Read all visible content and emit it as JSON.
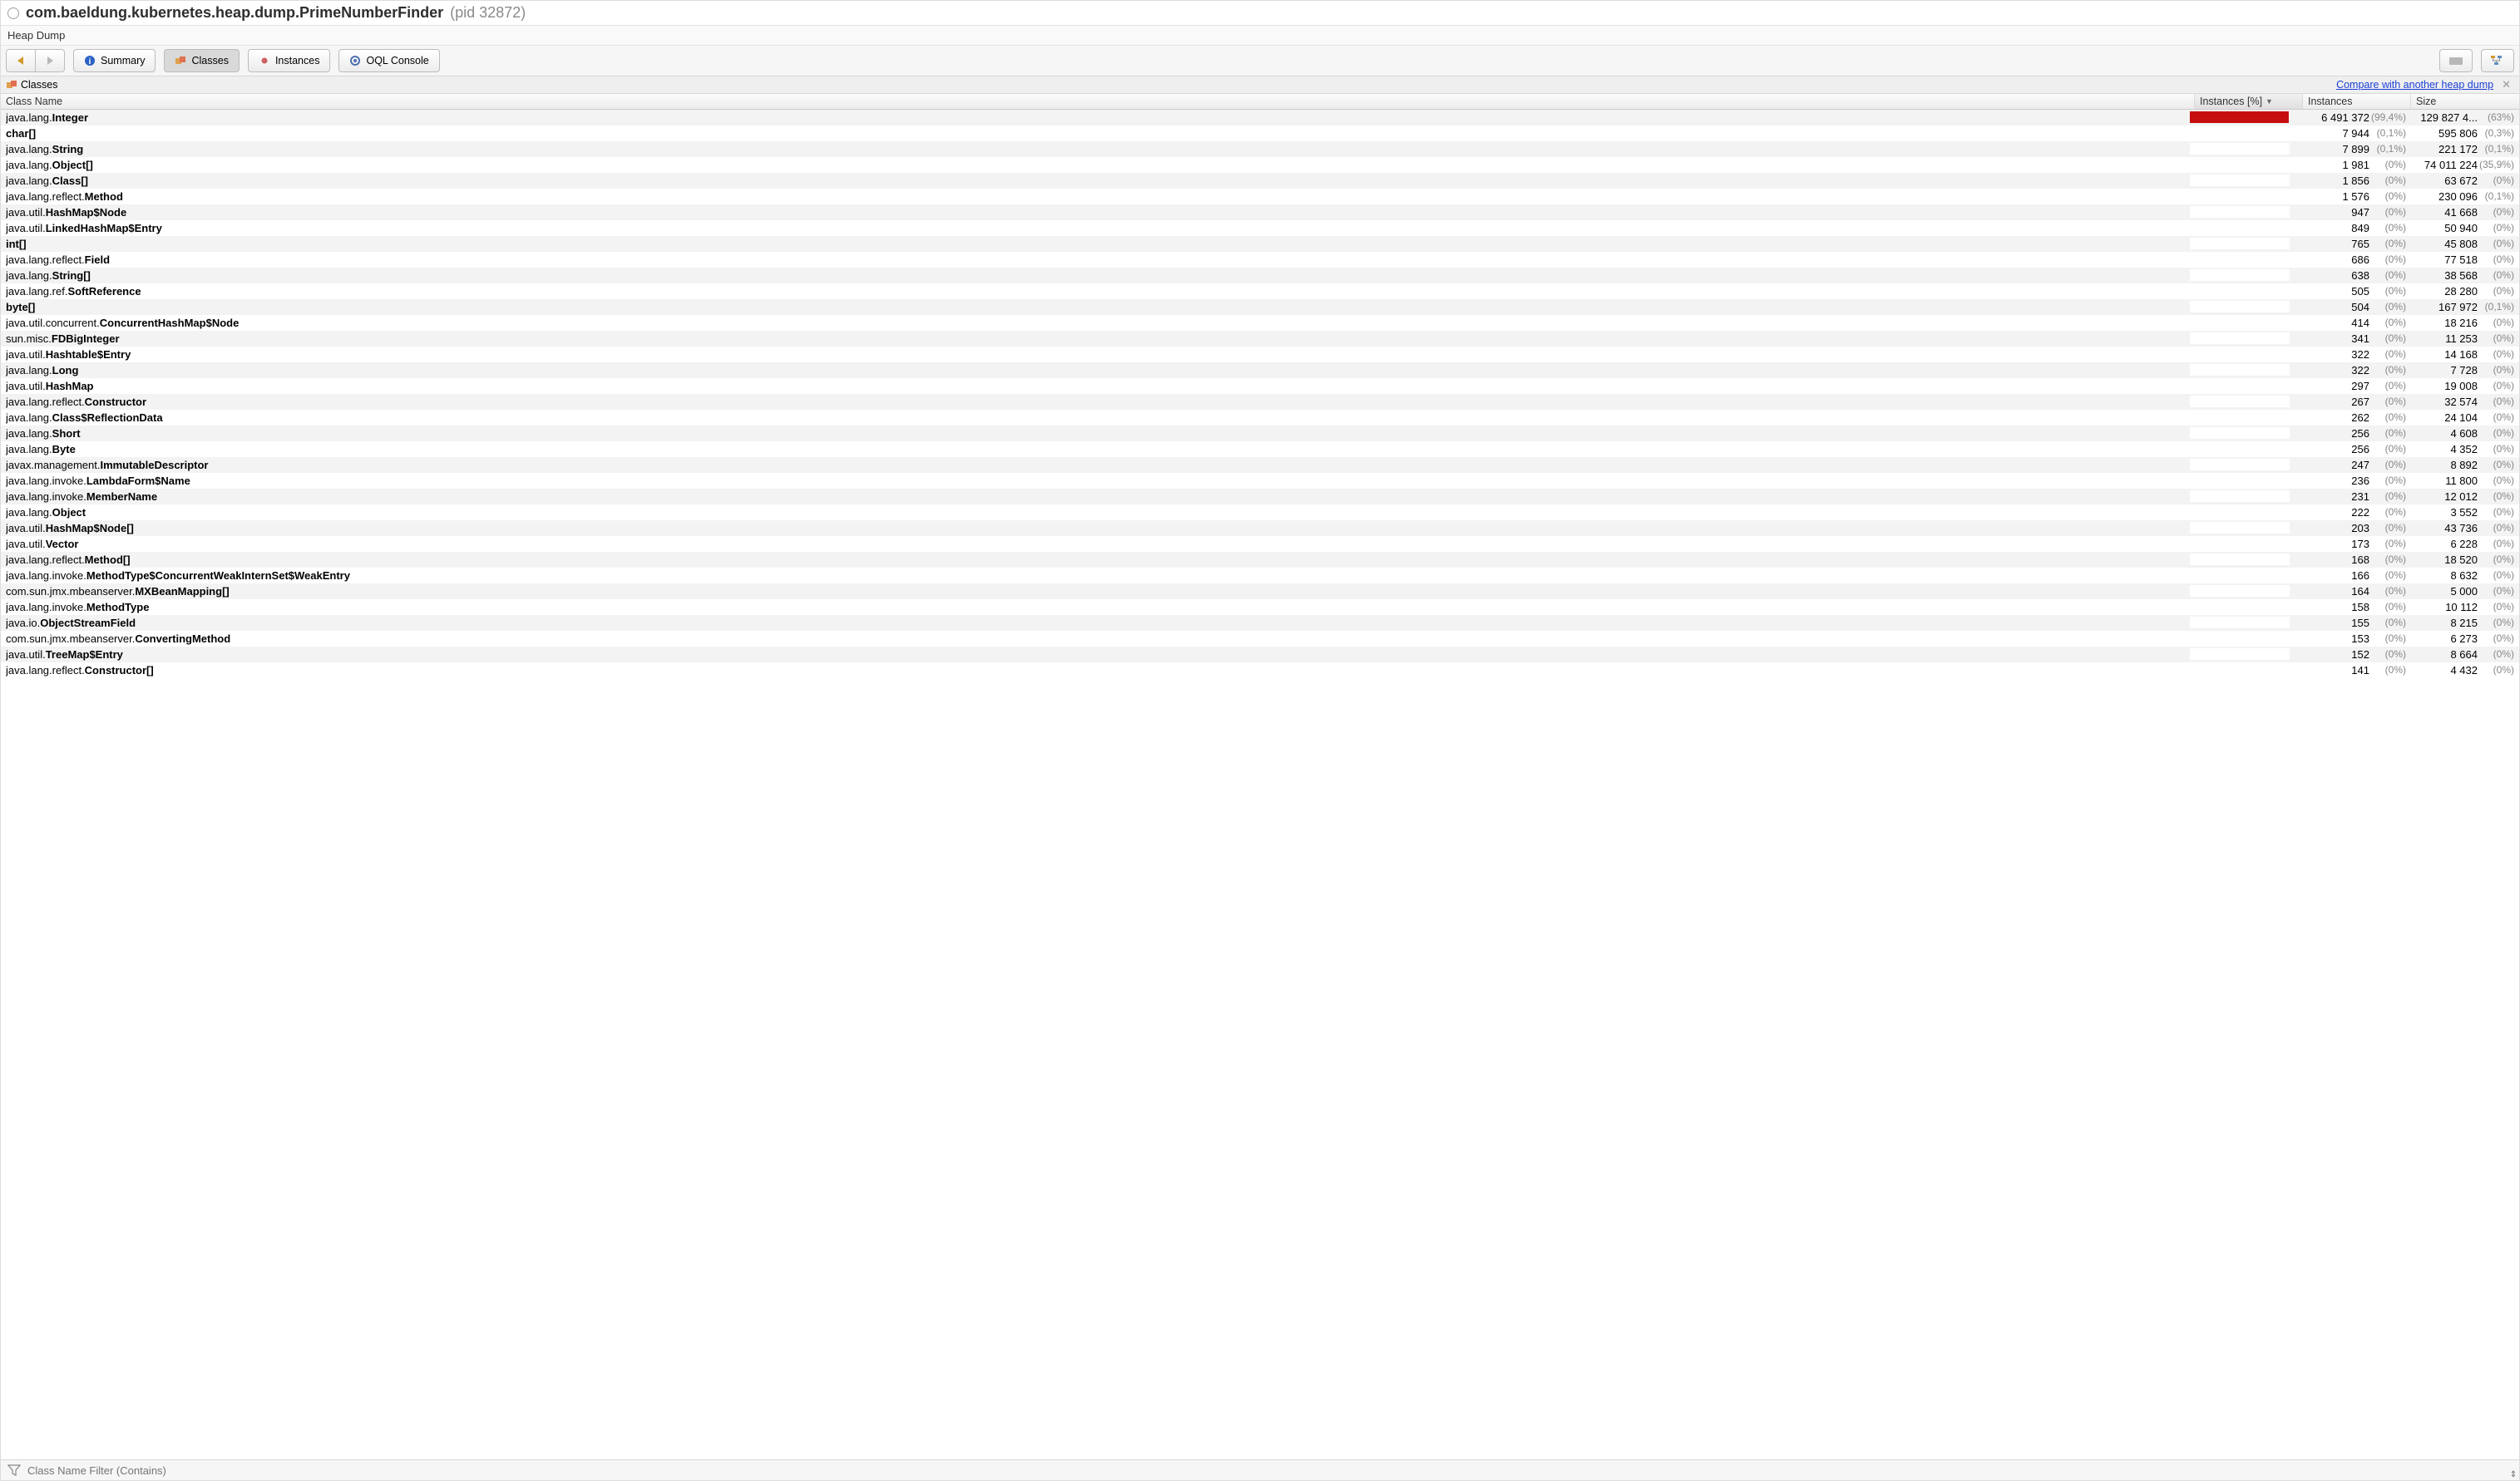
{
  "title": {
    "main": "com.baeldung.kubernetes.heap.dump.PrimeNumberFinder",
    "pid": "(pid 32872)"
  },
  "subheader": "Heap Dump",
  "toolbar": {
    "summary": "Summary",
    "classes": "Classes",
    "instances": "Instances",
    "oql": "OQL Console"
  },
  "section": {
    "label": "Classes",
    "compare_link": "Compare with another heap dump"
  },
  "columns": {
    "name": "Class Name",
    "pct": "Instances [%]",
    "instances": "Instances",
    "size": "Size"
  },
  "filter_placeholder": "Class Name Filter (Contains)",
  "rows": [
    {
      "pkg": "java.lang.",
      "cls": "Integer",
      "bar": 99.4,
      "inst": "6 491 372",
      "inst_pct": "(99,4%)",
      "size": "129 827 4...",
      "size_pct": "(63%)"
    },
    {
      "pkg": "",
      "cls": "char[]",
      "bar": 0,
      "inst": "7 944",
      "inst_pct": "(0,1%)",
      "size": "595 806",
      "size_pct": "(0,3%)"
    },
    {
      "pkg": "java.lang.",
      "cls": "String",
      "bar": 0,
      "inst": "7 899",
      "inst_pct": "(0,1%)",
      "size": "221 172",
      "size_pct": "(0,1%)"
    },
    {
      "pkg": "java.lang.",
      "cls": "Object[]",
      "bar": 0,
      "inst": "1 981",
      "inst_pct": "(0%)",
      "size": "74 011 224",
      "size_pct": "(35,9%)"
    },
    {
      "pkg": "java.lang.",
      "cls": "Class[]",
      "bar": 0,
      "inst": "1 856",
      "inst_pct": "(0%)",
      "size": "63 672",
      "size_pct": "(0%)"
    },
    {
      "pkg": "java.lang.reflect.",
      "cls": "Method",
      "bar": 0,
      "inst": "1 576",
      "inst_pct": "(0%)",
      "size": "230 096",
      "size_pct": "(0,1%)"
    },
    {
      "pkg": "java.util.",
      "cls": "HashMap$Node",
      "bar": 0,
      "inst": "947",
      "inst_pct": "(0%)",
      "size": "41 668",
      "size_pct": "(0%)"
    },
    {
      "pkg": "java.util.",
      "cls": "LinkedHashMap$Entry",
      "bar": 0,
      "inst": "849",
      "inst_pct": "(0%)",
      "size": "50 940",
      "size_pct": "(0%)"
    },
    {
      "pkg": "",
      "cls": "int[]",
      "bar": 0,
      "inst": "765",
      "inst_pct": "(0%)",
      "size": "45 808",
      "size_pct": "(0%)"
    },
    {
      "pkg": "java.lang.reflect.",
      "cls": "Field",
      "bar": 0,
      "inst": "686",
      "inst_pct": "(0%)",
      "size": "77 518",
      "size_pct": "(0%)"
    },
    {
      "pkg": "java.lang.",
      "cls": "String[]",
      "bar": 0,
      "inst": "638",
      "inst_pct": "(0%)",
      "size": "38 568",
      "size_pct": "(0%)"
    },
    {
      "pkg": "java.lang.ref.",
      "cls": "SoftReference",
      "bar": 0,
      "inst": "505",
      "inst_pct": "(0%)",
      "size": "28 280",
      "size_pct": "(0%)"
    },
    {
      "pkg": "",
      "cls": "byte[]",
      "bar": 0,
      "inst": "504",
      "inst_pct": "(0%)",
      "size": "167 972",
      "size_pct": "(0,1%)"
    },
    {
      "pkg": "java.util.concurrent.",
      "cls": "ConcurrentHashMap$Node",
      "bar": 0,
      "inst": "414",
      "inst_pct": "(0%)",
      "size": "18 216",
      "size_pct": "(0%)"
    },
    {
      "pkg": "sun.misc.",
      "cls": "FDBigInteger",
      "bar": 0,
      "inst": "341",
      "inst_pct": "(0%)",
      "size": "11 253",
      "size_pct": "(0%)"
    },
    {
      "pkg": "java.util.",
      "cls": "Hashtable$Entry",
      "bar": 0,
      "inst": "322",
      "inst_pct": "(0%)",
      "size": "14 168",
      "size_pct": "(0%)"
    },
    {
      "pkg": "java.lang.",
      "cls": "Long",
      "bar": 0,
      "inst": "322",
      "inst_pct": "(0%)",
      "size": "7 728",
      "size_pct": "(0%)"
    },
    {
      "pkg": "java.util.",
      "cls": "HashMap",
      "bar": 0,
      "inst": "297",
      "inst_pct": "(0%)",
      "size": "19 008",
      "size_pct": "(0%)"
    },
    {
      "pkg": "java.lang.reflect.",
      "cls": "Constructor",
      "bar": 0,
      "inst": "267",
      "inst_pct": "(0%)",
      "size": "32 574",
      "size_pct": "(0%)"
    },
    {
      "pkg": "java.lang.",
      "cls": "Class$ReflectionData",
      "bar": 0,
      "inst": "262",
      "inst_pct": "(0%)",
      "size": "24 104",
      "size_pct": "(0%)"
    },
    {
      "pkg": "java.lang.",
      "cls": "Short",
      "bar": 0,
      "inst": "256",
      "inst_pct": "(0%)",
      "size": "4 608",
      "size_pct": "(0%)"
    },
    {
      "pkg": "java.lang.",
      "cls": "Byte",
      "bar": 0,
      "inst": "256",
      "inst_pct": "(0%)",
      "size": "4 352",
      "size_pct": "(0%)"
    },
    {
      "pkg": "javax.management.",
      "cls": "ImmutableDescriptor",
      "bar": 0,
      "inst": "247",
      "inst_pct": "(0%)",
      "size": "8 892",
      "size_pct": "(0%)"
    },
    {
      "pkg": "java.lang.invoke.",
      "cls": "LambdaForm$Name",
      "bar": 0,
      "inst": "236",
      "inst_pct": "(0%)",
      "size": "11 800",
      "size_pct": "(0%)"
    },
    {
      "pkg": "java.lang.invoke.",
      "cls": "MemberName",
      "bar": 0,
      "inst": "231",
      "inst_pct": "(0%)",
      "size": "12 012",
      "size_pct": "(0%)"
    },
    {
      "pkg": "java.lang.",
      "cls": "Object",
      "bar": 0,
      "inst": "222",
      "inst_pct": "(0%)",
      "size": "3 552",
      "size_pct": "(0%)"
    },
    {
      "pkg": "java.util.",
      "cls": "HashMap$Node[]",
      "bar": 0,
      "inst": "203",
      "inst_pct": "(0%)",
      "size": "43 736",
      "size_pct": "(0%)"
    },
    {
      "pkg": "java.util.",
      "cls": "Vector",
      "bar": 0,
      "inst": "173",
      "inst_pct": "(0%)",
      "size": "6 228",
      "size_pct": "(0%)"
    },
    {
      "pkg": "java.lang.reflect.",
      "cls": "Method[]",
      "bar": 0,
      "inst": "168",
      "inst_pct": "(0%)",
      "size": "18 520",
      "size_pct": "(0%)"
    },
    {
      "pkg": "java.lang.invoke.",
      "cls": "MethodType$ConcurrentWeakInternSet$WeakEntry",
      "bar": 0,
      "inst": "166",
      "inst_pct": "(0%)",
      "size": "8 632",
      "size_pct": "(0%)"
    },
    {
      "pkg": "com.sun.jmx.mbeanserver.",
      "cls": "MXBeanMapping[]",
      "bar": 0,
      "inst": "164",
      "inst_pct": "(0%)",
      "size": "5 000",
      "size_pct": "(0%)"
    },
    {
      "pkg": "java.lang.invoke.",
      "cls": "MethodType",
      "bar": 0,
      "inst": "158",
      "inst_pct": "(0%)",
      "size": "10 112",
      "size_pct": "(0%)"
    },
    {
      "pkg": "java.io.",
      "cls": "ObjectStreamField",
      "bar": 0,
      "inst": "155",
      "inst_pct": "(0%)",
      "size": "8 215",
      "size_pct": "(0%)"
    },
    {
      "pkg": "com.sun.jmx.mbeanserver.",
      "cls": "ConvertingMethod",
      "bar": 0,
      "inst": "153",
      "inst_pct": "(0%)",
      "size": "6 273",
      "size_pct": "(0%)"
    },
    {
      "pkg": "java.util.",
      "cls": "TreeMap$Entry",
      "bar": 0,
      "inst": "152",
      "inst_pct": "(0%)",
      "size": "8 664",
      "size_pct": "(0%)"
    },
    {
      "pkg": "java.lang.reflect.",
      "cls": "Constructor[]",
      "bar": 0,
      "inst": "141",
      "inst_pct": "(0%)",
      "size": "4 432",
      "size_pct": "(0%)"
    }
  ]
}
